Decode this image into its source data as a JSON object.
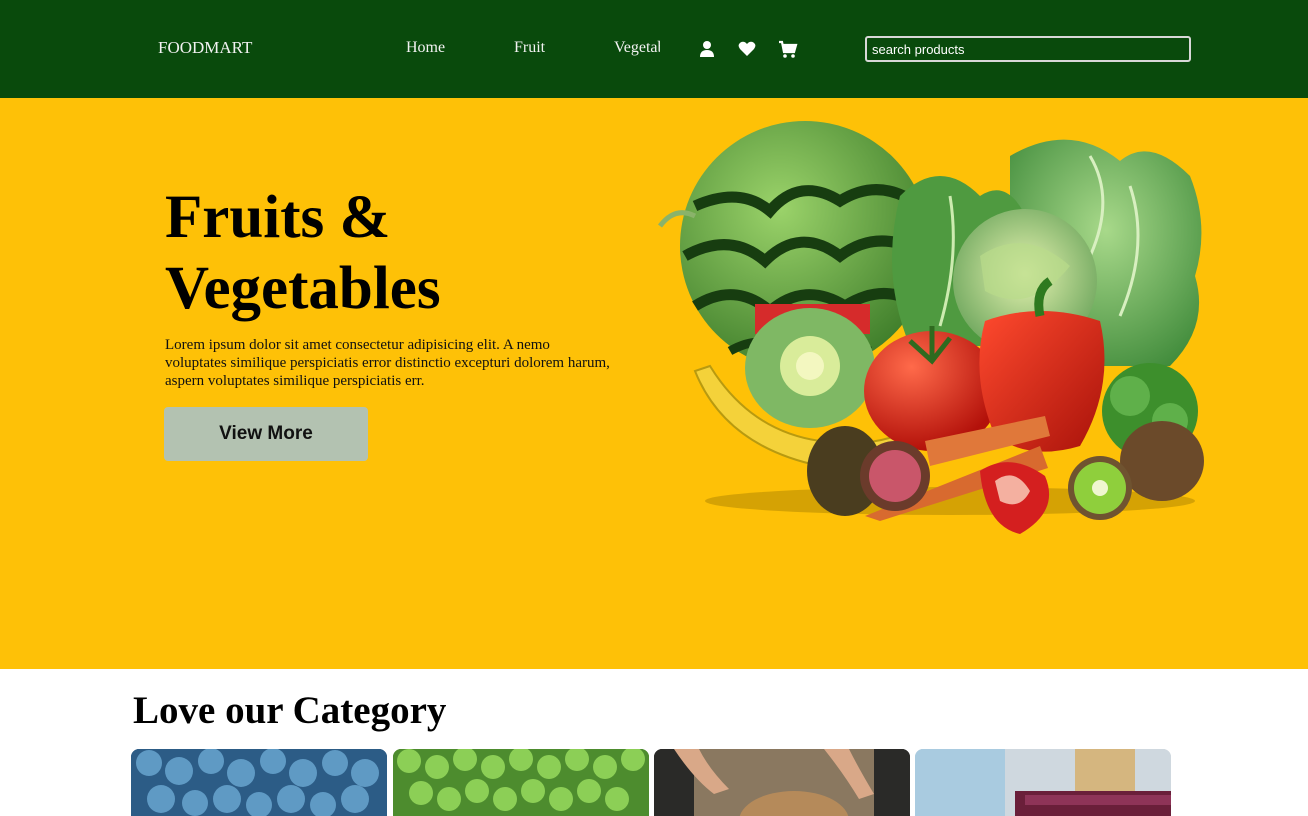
{
  "navbar": {
    "brand": "FOODMART",
    "links": [
      "Home",
      "Fruit",
      "Vegetables"
    ],
    "search_placeholder": "search products",
    "icons": [
      "user-icon",
      "heart-icon",
      "cart-icon"
    ],
    "background": "#094a0c"
  },
  "hero": {
    "title": "Fruits & Vegetables",
    "description": "Lorem ipsum dolor sit amet consectetur adipisicing elit. A nemo voluptates similique perspiciatis error distinctio excepturi dolorem harum, aspern voluptates similique perspiciatis err.",
    "button_label": "View More",
    "background": "#fec107",
    "button_color": "#b3c2b1"
  },
  "category": {
    "title": "Love our Category"
  }
}
